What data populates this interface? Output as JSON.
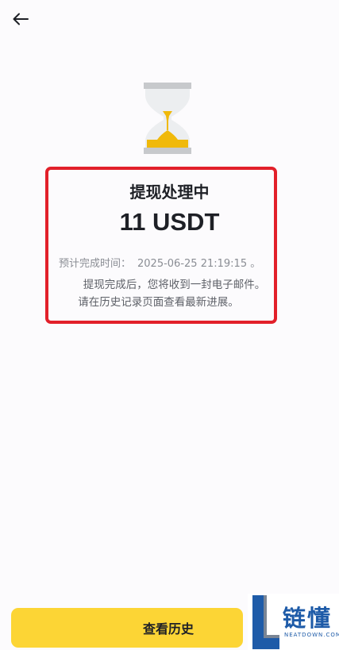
{
  "header": {
    "back_icon": "arrow-left-icon"
  },
  "status": {
    "icon": "hourglass-icon",
    "title": "提现处理中",
    "amount": "11 USDT",
    "eta_label": "预计完成时间：",
    "eta_value": "2025-06-25 21:19:15 。",
    "info_line1": "提现完成后，您将收到一封电子邮件。",
    "info_line2": "请在历史记录页面查看最新进展。"
  },
  "actions": {
    "history_button_label": "查看历史"
  },
  "watermark": {
    "name": "链懂",
    "domain": "NEATDOWN.COM"
  },
  "colors": {
    "accent": "#fcd535",
    "highlight": "#e2202a",
    "hourglass_sand": "#f0b90b",
    "hourglass_cap": "#c7c9cc"
  }
}
